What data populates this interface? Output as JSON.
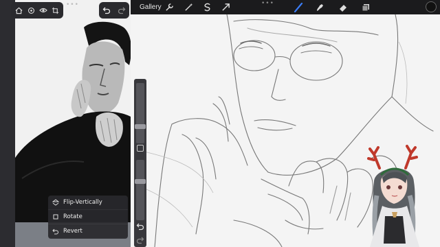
{
  "app": {
    "gallery_label": "Gallery"
  },
  "reference_menu": {
    "items": [
      {
        "label": "Flip-Vertically",
        "icon": "flip-vertical-icon"
      },
      {
        "label": "Rotate",
        "icon": "rotate-icon"
      },
      {
        "label": "Revert",
        "icon": "revert-icon"
      }
    ]
  },
  "top_tools": [
    {
      "name": "actions-wrench-icon"
    },
    {
      "name": "adjustments-wand-icon"
    },
    {
      "name": "selection-s-icon"
    },
    {
      "name": "transform-arrow-icon"
    },
    {
      "name": "brush-icon"
    },
    {
      "name": "smudge-icon"
    },
    {
      "name": "eraser-icon"
    },
    {
      "name": "layers-icon"
    }
  ],
  "colors": {
    "active_tool": "#3b7cf5",
    "current_color": "#111111"
  }
}
